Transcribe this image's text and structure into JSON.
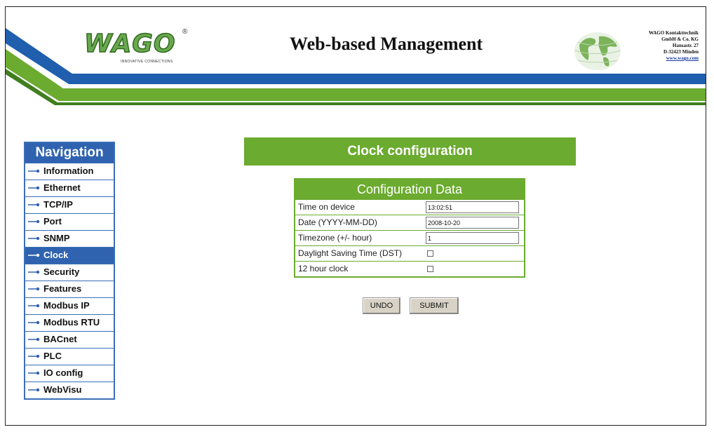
{
  "header": {
    "logo_text": "WAGO",
    "logo_registered": "®",
    "logo_tagline": "INNOVATIVE CONNECTIONS",
    "title": "Web-based Management",
    "address_lines": [
      "WAGO Kontakttechnik",
      "GmbH & Co. KG",
      "Hansastr. 27",
      "D-32423 Minden"
    ],
    "address_link": "www.wago.com"
  },
  "navigation": {
    "title": "Navigation",
    "items": [
      {
        "label": "Information",
        "active": false
      },
      {
        "label": "Ethernet",
        "active": false
      },
      {
        "label": "TCP/IP",
        "active": false
      },
      {
        "label": "Port",
        "active": false
      },
      {
        "label": "SNMP",
        "active": false
      },
      {
        "label": "Clock",
        "active": true
      },
      {
        "label": "Security",
        "active": false
      },
      {
        "label": "Features",
        "active": false
      },
      {
        "label": "Modbus IP",
        "active": false
      },
      {
        "label": "Modbus RTU",
        "active": false
      },
      {
        "label": "BACnet",
        "active": false
      },
      {
        "label": "PLC",
        "active": false
      },
      {
        "label": "IO config",
        "active": false
      },
      {
        "label": "WebVisu",
        "active": false
      }
    ]
  },
  "main": {
    "banner": "Clock configuration",
    "config": {
      "heading": "Configuration Data",
      "time_label": "Time on device",
      "time_value": "13:02:51",
      "date_label": "Date (YYYY-MM-DD)",
      "date_value": "2008-10-20",
      "timezone_label": "Timezone (+/- hour)",
      "timezone_value": "1",
      "dst_label": "Daylight Saving Time (DST)",
      "dst_checked": false,
      "hour12_label": "12 hour clock",
      "hour12_checked": false
    },
    "buttons": {
      "undo": "UNDO",
      "submit": "SUBMIT"
    }
  },
  "colors": {
    "nav_blue": "#2f63b0",
    "wago_green": "#6bab2f",
    "stripe_blue": "#1f5fae"
  }
}
